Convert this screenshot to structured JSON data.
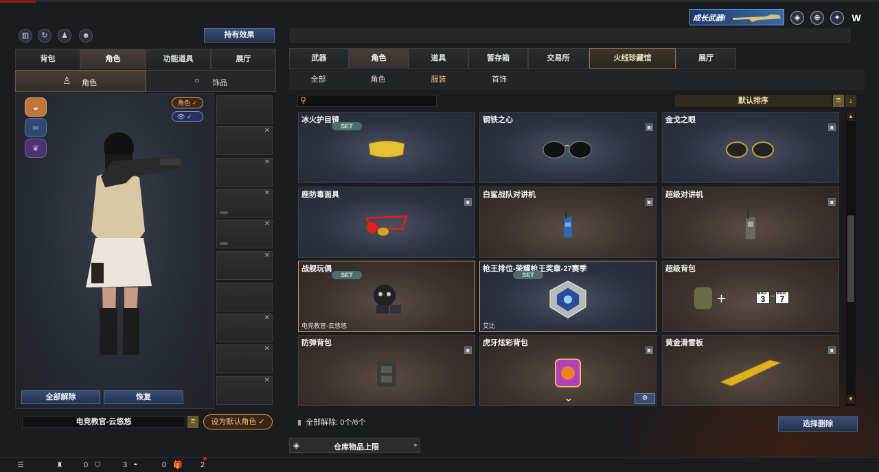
{
  "left_panel": {
    "hold_effect_label": "持有效果",
    "tabs": [
      "背包",
      "角色",
      "功能道具",
      "展厅"
    ],
    "active_tab": "角色",
    "subtabs": [
      "角色",
      "饰品"
    ],
    "toggle_role_label": "角色 ✓",
    "toggle_eye_label": "✓",
    "unequip_all_label": "全部解除",
    "restore_label": "恢复",
    "character_name": "电竞教官-云悠悠",
    "set_default_label": "设为默认角色 ✓"
  },
  "right_panel": {
    "tabs": [
      "武器",
      "角色",
      "道具",
      "暂存箱",
      "交易所",
      "火线珍藏馆",
      "展厅"
    ],
    "active_tab": "角色",
    "subtabs": [
      "全部",
      "角色",
      "服装",
      "首饰"
    ],
    "active_subtab": "服装",
    "search_placeholder": "",
    "sort_label": "默认排序",
    "items": [
      {
        "name": "冰火护目镜",
        "set": "SET",
        "style": "blue",
        "art": "visor"
      },
      {
        "name": "钢铁之心",
        "style": "blue",
        "lock": true,
        "art": "sunglasses"
      },
      {
        "name": "金戈之眼",
        "style": "blue",
        "lock": true,
        "art": "goldglasses"
      },
      {
        "name": "鹿防毒面具",
        "style": "blue",
        "lock": true,
        "art": "mask"
      },
      {
        "name": "白鲨战队对讲机",
        "style": "brown",
        "lock": true,
        "art": "radio"
      },
      {
        "name": "超级对讲机",
        "style": "brown",
        "lock": true,
        "art": "radio2"
      },
      {
        "name": "战舰玩偶",
        "set": "SET",
        "style": "brown",
        "highlight": true,
        "footer": "电竞教官-云悠悠",
        "art": "doll"
      },
      {
        "name": "枪王排位-荣耀枪王奖章-27赛季",
        "set": "SET",
        "style": "blue",
        "highlight": true,
        "footer": "艾比",
        "art": "medal"
      },
      {
        "name": "超级背包",
        "style": "brown",
        "art": "bag",
        "bag_from": "3",
        "bag_to": "7",
        "bag_tag": "BAG"
      },
      {
        "name": "防弹背包",
        "style": "brown",
        "lock": true,
        "art": "vest"
      },
      {
        "name": "虎牙炫彩背包",
        "style": "brown",
        "lock": true,
        "art": "huya"
      },
      {
        "name": "黄金滑雪板",
        "style": "brown",
        "lock": true,
        "art": "board"
      }
    ],
    "unequip_all_status": "全部解除: 0个/6个",
    "choose_remove_label": "选择删除",
    "warehouse_limit_label": "仓库物品上限"
  },
  "top_banner": {
    "text": "成长武器!"
  },
  "bottom_bar": {
    "count1": "0",
    "count2": "3",
    "count3": "0",
    "count4": "2"
  },
  "colors": {
    "accent_gold": "#c79a62",
    "button_blue": "#3a4e74",
    "orange": "#e0a050"
  }
}
